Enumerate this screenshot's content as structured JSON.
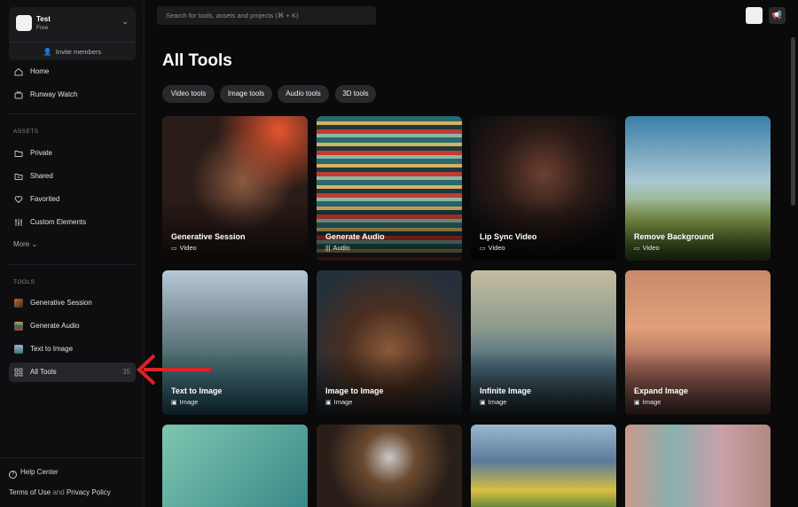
{
  "workspace": {
    "name": "Test",
    "plan": "Free",
    "invite_label": "Invite members"
  },
  "nav": {
    "home": "Home",
    "watch": "Runway Watch",
    "assets_header": "ASSETS",
    "private": "Private",
    "shared": "Shared",
    "favorited": "Favorited",
    "custom": "Custom Elements",
    "more": "More",
    "tools_header": "TOOLS",
    "gen_session": "Generative Session",
    "gen_audio": "Generate Audio",
    "text_image": "Text to Image",
    "all_tools": "All Tools",
    "all_tools_count": "35"
  },
  "footer": {
    "help": "Help Center",
    "terms": "Terms of Use",
    "and": "and",
    "privacy": "Privacy Policy"
  },
  "search": {
    "placeholder": "Search for tools, assets and projects (⌘ + K)"
  },
  "page": {
    "title": "All Tools"
  },
  "filters": [
    "Video tools",
    "Image tools",
    "Audio tools",
    "3D tools"
  ],
  "cards": [
    {
      "title": "Generative Session",
      "type": "Video"
    },
    {
      "title": "Generate Audio",
      "type": "Audio"
    },
    {
      "title": "Lip Sync Video",
      "type": "Video"
    },
    {
      "title": "Remove Background",
      "type": "Video"
    },
    {
      "title": "Text to Image",
      "type": "Image"
    },
    {
      "title": "Image to Image",
      "type": "Image"
    },
    {
      "title": "Infinite Image",
      "type": "Image"
    },
    {
      "title": "Expand Image",
      "type": "Image"
    }
  ],
  "colors": {
    "accent_arrow": "#d8232a",
    "background": "#0a0a0b",
    "sidebar": "#0e0e10"
  }
}
